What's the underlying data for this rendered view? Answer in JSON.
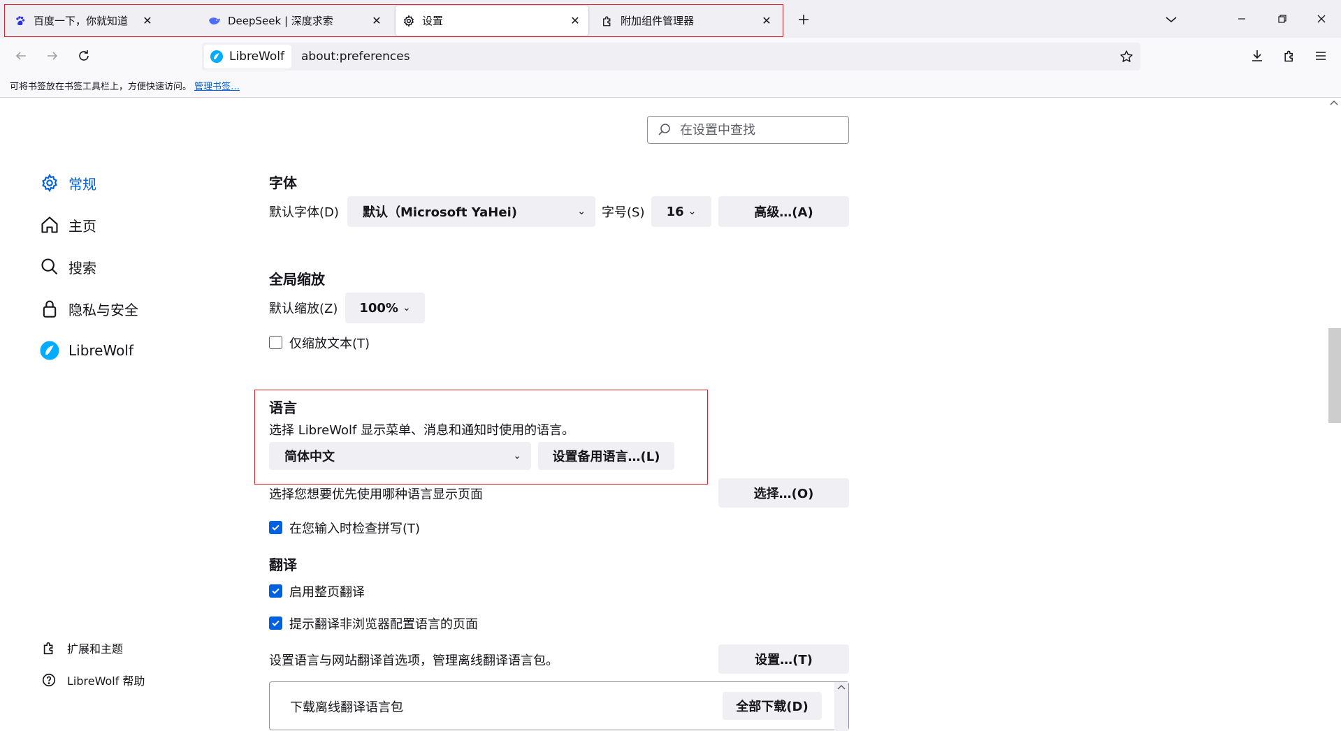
{
  "tabs": [
    {
      "title": "百度一下，你就知道",
      "icon": "baidu-paw-icon",
      "active": false
    },
    {
      "title": "DeepSeek | 深度求索",
      "icon": "deepseek-whale-icon",
      "active": false
    },
    {
      "title": "设置",
      "icon": "gear-icon",
      "active": true
    },
    {
      "title": "附加组件管理器",
      "icon": "puzzle-icon",
      "active": false
    }
  ],
  "tab_close_glyph": "✕",
  "urlbar": {
    "identity_label": "LibreWolf",
    "url": "about:preferences"
  },
  "bookmarks_bar": {
    "hint": "可将书签放在书签工具栏上，方便快速访问。",
    "manage_link": "管理书签…"
  },
  "search": {
    "placeholder": "在设置中查找"
  },
  "categories": [
    {
      "label": "常规",
      "icon": "gear-icon",
      "selected": true
    },
    {
      "label": "主页",
      "icon": "home-icon",
      "selected": false
    },
    {
      "label": "搜索",
      "icon": "search-icon",
      "selected": false
    },
    {
      "label": "隐私与安全",
      "icon": "lock-icon",
      "selected": false
    },
    {
      "label": "LibreWolf",
      "icon": "librewolf-icon",
      "selected": false
    }
  ],
  "footer_links": [
    {
      "label": "扩展和主题",
      "icon": "puzzle-icon"
    },
    {
      "label": "LibreWolf 帮助",
      "icon": "help-icon"
    }
  ],
  "fonts": {
    "heading": "字体",
    "default_font_label": "默认字体(D)",
    "default_font_value": "默认（Microsoft YaHei)",
    "size_label": "字号(S)",
    "size_value": "16",
    "advanced_button": "高级…(A)"
  },
  "zoom": {
    "heading": "全局缩放",
    "default_zoom_label": "默认缩放(Z)",
    "default_zoom_value": "100%",
    "zoom_text_only_label": "仅缩放文本(T)",
    "zoom_text_only_checked": false
  },
  "language": {
    "heading": "语言",
    "description": "选择 LibreWolf 显示菜单、消息和通知时使用的语言。",
    "ui_language_value": "简体中文",
    "alternatives_button": "设置备用语言…(L)",
    "page_language_label": "选择您想要优先使用哪种语言显示页面",
    "choose_button": "选择…(O)",
    "spellcheck_label": "在您输入时检查拼写(T)",
    "spellcheck_checked": true
  },
  "translation": {
    "heading": "翻译",
    "enable_full_page_label": "启用整页翻译",
    "enable_full_page_checked": true,
    "offer_translate_label": "提示翻译非浏览器配置语言的页面",
    "offer_translate_checked": true,
    "settings_label": "设置语言与网站翻译首选项，管理离线翻译语言包。",
    "settings_button": "设置…(T)",
    "download_packs_label": "下载离线翻译语言包",
    "download_all_button": "全部下载(D)"
  },
  "colors": {
    "accent": "#0061e0",
    "highlight_border": "#e0242b"
  }
}
